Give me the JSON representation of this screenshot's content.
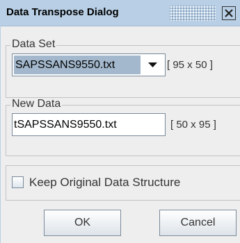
{
  "dialog": {
    "title": "Data Transpose Dialog"
  },
  "icons": {
    "close": "close-icon",
    "dropdown": "triangle-down-icon"
  },
  "data_set": {
    "group_label": "Data Set",
    "selected_file": "SAPSSANS9550.txt",
    "dimensions": "[ 95 x 50 ]"
  },
  "new_data": {
    "group_label": "New Data",
    "file_name": "tSAPSSANS9550.txt",
    "dimensions": "[ 50 x 95 ]"
  },
  "options": {
    "keep_structure_label": "Keep Original Data Structure",
    "keep_structure_checked": false
  },
  "buttons": {
    "ok_label": "OK",
    "cancel_label": "Cancel"
  },
  "colors": {
    "titlebar": "#b8cfe5",
    "selection": "#a3b8cc",
    "panel": "#eeeeee"
  }
}
